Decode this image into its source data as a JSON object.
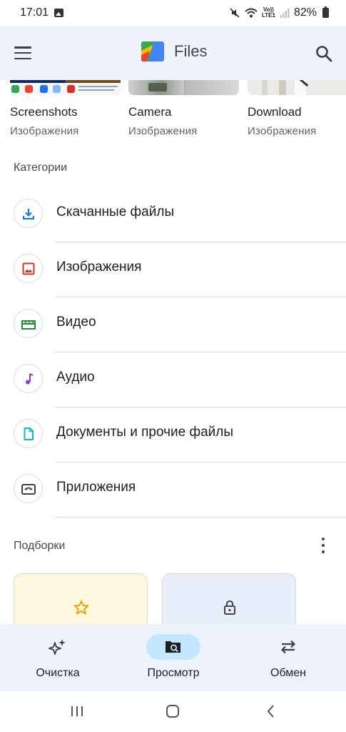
{
  "status": {
    "time": "17:01",
    "battery": "82%",
    "network_top": "Vo))",
    "network_bottom": "LTE1"
  },
  "app_bar": {
    "title": "Files"
  },
  "folders": [
    {
      "name": "Screenshots",
      "type": "Изображения"
    },
    {
      "name": "Camera",
      "type": "Изображения"
    },
    {
      "name": "Download",
      "type": "Изображения"
    }
  ],
  "categories": {
    "title": "Категории",
    "items": [
      {
        "label": "Скачанные файлы",
        "icon": "download-icon",
        "color": "#1a73e8"
      },
      {
        "label": "Изображения",
        "icon": "image-icon",
        "color": "#d93025"
      },
      {
        "label": "Видео",
        "icon": "video-icon",
        "color": "#1e8e3e"
      },
      {
        "label": "Аудио",
        "icon": "music-note-icon",
        "color": "#9334e6"
      },
      {
        "label": "Документы и прочие файлы",
        "icon": "document-icon",
        "color": "#12b5cb"
      },
      {
        "label": "Приложения",
        "icon": "android-icon",
        "color": "#3c4043"
      }
    ]
  },
  "collections": {
    "title": "Подборки",
    "cards": [
      {
        "icon": "star-icon",
        "color": "#fbbc04",
        "background": "#fef7e0"
      },
      {
        "icon": "lock-icon",
        "color": "#444746",
        "background": "#e8effa"
      }
    ]
  },
  "bottom_nav": {
    "items": [
      {
        "label": "Очистка",
        "icon": "sparkle-icon"
      },
      {
        "label": "Просмотр",
        "icon": "folder-search-icon",
        "selected": true
      },
      {
        "label": "Обмен",
        "icon": "swap-icon"
      }
    ]
  },
  "colors": {
    "accent": "#1a73e8",
    "surface": "#eef2fa",
    "selected_pill": "#c2e7ff"
  }
}
